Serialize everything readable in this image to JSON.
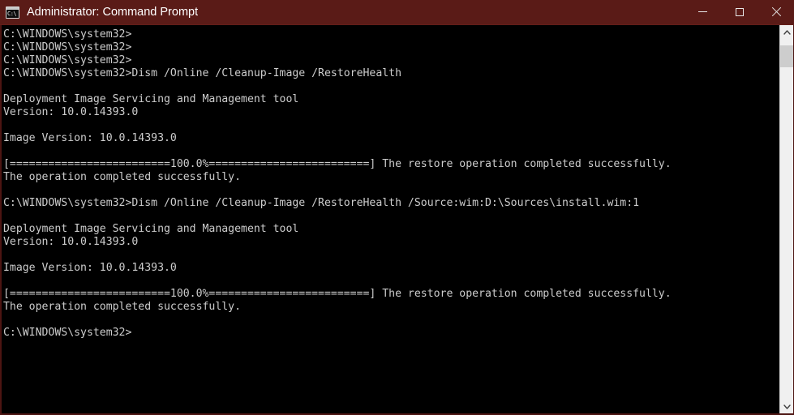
{
  "window": {
    "title": "Administrator: Command Prompt",
    "icon_name": "command-prompt-icon",
    "icon_text": "C:\\",
    "titlebar_color": "#5a1b17",
    "console_bg": "#000000",
    "console_fg": "#cccccc",
    "controls": {
      "minimize_label": "Minimize",
      "maximize_label": "Maximize",
      "close_label": "Close"
    }
  },
  "console": {
    "lines": [
      "C:\\WINDOWS\\system32>",
      "C:\\WINDOWS\\system32>",
      "C:\\WINDOWS\\system32>",
      "C:\\WINDOWS\\system32>Dism /Online /Cleanup-Image /RestoreHealth",
      "",
      "Deployment Image Servicing and Management tool",
      "Version: 10.0.14393.0",
      "",
      "Image Version: 10.0.14393.0",
      "",
      "[=========================100.0%=========================] The restore operation completed successfully.",
      "The operation completed successfully.",
      "",
      "C:\\WINDOWS\\system32>Dism /Online /Cleanup-Image /RestoreHealth /Source:wim:D:\\Sources\\install.wim:1",
      "",
      "Deployment Image Servicing and Management tool",
      "Version: 10.0.14393.0",
      "",
      "Image Version: 10.0.14393.0",
      "",
      "[=========================100.0%=========================] The restore operation completed successfully.",
      "The operation completed successfully.",
      "",
      "C:\\WINDOWS\\system32>"
    ]
  },
  "scrollbar": {
    "up_arrow": "scroll-up",
    "down_arrow": "scroll-down",
    "thumb_position_percent": 2
  }
}
